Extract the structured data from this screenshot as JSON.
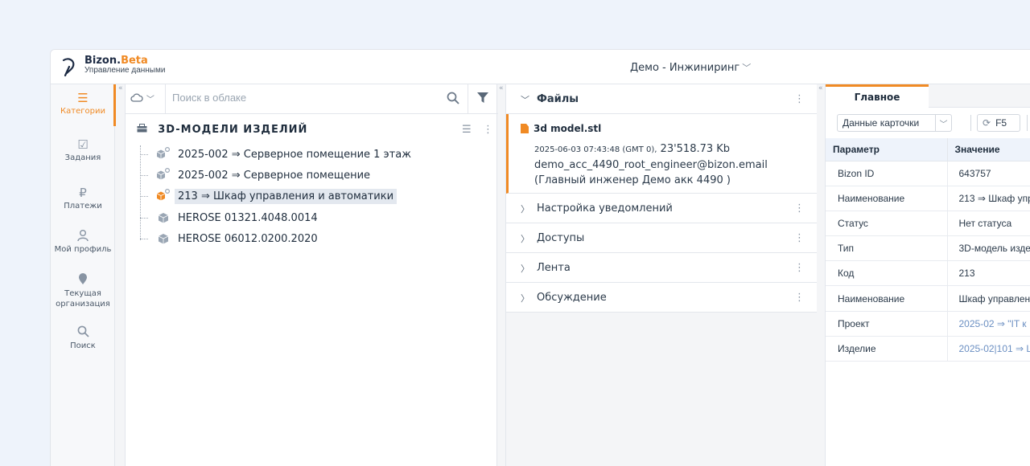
{
  "header": {
    "logo_name": "Bizon.",
    "logo_accent": "Beta",
    "logo_sub": "Управление данными",
    "organization": "Демо - Инжиниринг"
  },
  "sidebar": {
    "items": [
      {
        "label": "Категории",
        "icon": "menu-icon"
      },
      {
        "label": "Задания",
        "icon": "checkbox-icon"
      },
      {
        "label": "Платежи",
        "icon": "ruble-icon"
      },
      {
        "label": "Мой профиль",
        "icon": "user-icon"
      },
      {
        "label": "Текущая организация",
        "icon": "location-pin-icon"
      },
      {
        "label": "Поиск",
        "icon": "search-icon"
      }
    ]
  },
  "tree": {
    "search_placeholder": "Поиск в облаке",
    "title": "3D-МОДЕЛИ ИЗДЕЛИЙ",
    "items": [
      {
        "label": "2025-002 ⇒ Серверное помещение 1 этаж",
        "icon": "shared-cube-icon"
      },
      {
        "label": "2025-002 ⇒ Серверное помещение",
        "icon": "shared-cube-icon"
      },
      {
        "label": "213 ⇒ Шкаф управления и автоматики",
        "icon": "shared-cube-orange-icon"
      },
      {
        "label": "HEROSE 01321.4048.0014",
        "icon": "cube-icon"
      },
      {
        "label": "HEROSE 06012.0200.2020",
        "icon": "cube-icon"
      }
    ]
  },
  "files": {
    "section_title": "Файлы",
    "file": {
      "name": "3d model.stl",
      "timestamp": "2025-06-03 07:43:48 (GMT 0),",
      "size": "23'518.73 Kb",
      "owner": "demo_acc_4490_root_engineer@bizon.email (Главный инженер Демо акк 4490 )"
    },
    "sections": [
      "Настройка уведомлений",
      "Доступы",
      "Лента",
      "Обсуждение"
    ]
  },
  "details": {
    "tab": "Главное",
    "card_select": "Данные карточки",
    "refresh": "F5",
    "columns": [
      "Параметр",
      "Значение"
    ],
    "rows": [
      {
        "param": "Bizon ID",
        "value": "643757"
      },
      {
        "param": "Наименование",
        "value": "213 ⇒ Шкаф упр"
      },
      {
        "param": "Статус",
        "value": "Нет статуса"
      },
      {
        "param": "Тип",
        "value": "3D-модель изде"
      },
      {
        "param": "Код",
        "value": "213"
      },
      {
        "param": "Наименование",
        "value": "Шкаф управлен"
      },
      {
        "param": "Проект",
        "value": "2025-02 ⇒ \"IT к"
      },
      {
        "param": "Изделие",
        "value": "2025-02|101 ⇒ L"
      }
    ]
  },
  "colors": {
    "accent": "#f08a24",
    "link": "#6b8fc2",
    "header_row": "#eef3fb"
  }
}
